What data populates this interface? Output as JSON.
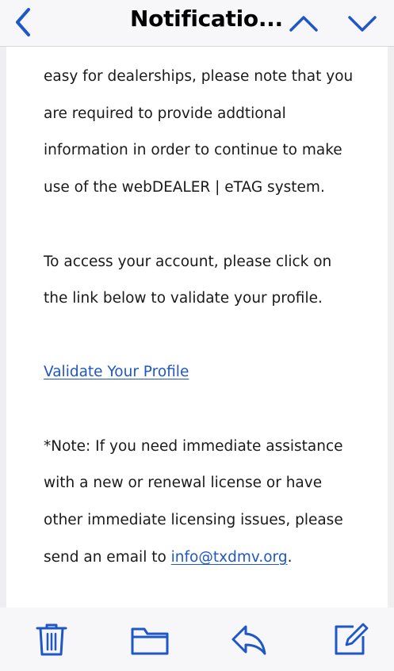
{
  "header": {
    "title": "Notificatio...",
    "back_icon": "chevron-left-icon",
    "prev_icon": "chevron-up-icon",
    "next_icon": "chevron-down-icon"
  },
  "body": {
    "lines": [
      "easy for dealerships, please note that you",
      "are required to provide addtional",
      "information in order to continue to make",
      "use of the webDEALER | eTAG system.",
      "To access your account, please click on",
      "the link below to validate your profile.",
      "*Note: If you need immediate assistance",
      "with a new or renewal license or have",
      "other immediate licensing issues, please"
    ],
    "validate_link": "Validate Your Profile",
    "last_line_prefix": "send an email to ",
    "email_link": "info@txdmv.org",
    "last_line_suffix": "."
  },
  "toolbar": {
    "items": [
      "trash-icon",
      "folder-icon",
      "reply-icon",
      "compose-icon"
    ]
  },
  "colors": {
    "accent": "#1f57c6",
    "text": "#1a1a1a",
    "chrome": "#f7f7f9"
  }
}
